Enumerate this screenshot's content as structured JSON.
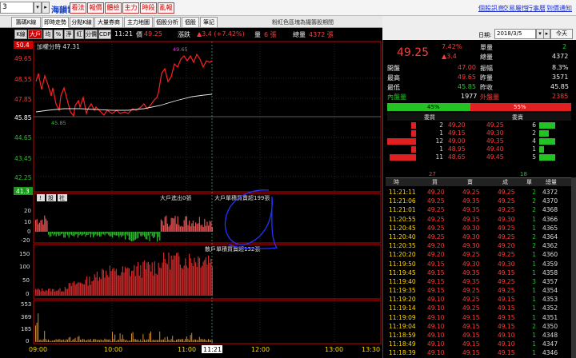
{
  "toolbar": {
    "stock_code": "3",
    "stock_name": "海韻電",
    "buttons": [
      "看法",
      "報價",
      "體檢",
      "主力",
      "時段",
      "亂報"
    ],
    "links": [
      "個股訊息",
      "交易屬性",
      "行事曆",
      "到價通知"
    ]
  },
  "tabs": [
    "籌碼K線",
    "即時走勢",
    "分點K線",
    "大量券商",
    "主力地圖",
    "個股分析",
    "個股",
    "筆記"
  ],
  "active_tab": "即時走勢",
  "chart_title": "粉紅色區塊為撮籌股期間",
  "chart_tools": [
    "K線",
    "大戶",
    "均",
    "%",
    "淨",
    "紅",
    "分價",
    "CDP"
  ],
  "time_display": "11:21",
  "price_label": "價",
  "price_value": "49.25",
  "change_label": "漲跌",
  "change_value": "▲3.4 (+7.42%)",
  "vol_label": "量",
  "vol_value": "6 張",
  "total_label": "總量",
  "total_value": "4372 張",
  "weighted_label": "加權分時 47.31",
  "price_axis": [
    "50.4",
    "49.65",
    "48.55",
    "47.85",
    "45.85",
    "44.65",
    "43.45",
    "42.25",
    "41.3"
  ],
  "open_label": "49.65",
  "low_label": "45.85",
  "panel2": {
    "header": "大戶進出0張",
    "axis": [
      "20",
      "10",
      "0",
      "-20"
    ],
    "annotation": "大戶單積買賣超199張",
    "buttons": [
      "!",
      "設",
      "社"
    ]
  },
  "panel3": {
    "annotation": "散戶單積買賣超132張",
    "axis": [
      "150",
      "100",
      "50",
      "0"
    ]
  },
  "panel4": {
    "axis": [
      "553",
      "369",
      "185",
      "0"
    ]
  },
  "time_axis": [
    "09:00",
    "10:00",
    "11:00",
    "11:21",
    "12:00",
    "13:00",
    "13:30"
  ],
  "date": {
    "label": "日期:",
    "value": "2018/3/5",
    "today": "今天"
  },
  "quote": {
    "price": "49.25",
    "pct": "7.42%",
    "change": "▲3.4",
    "labels": [
      "單量",
      "總量"
    ],
    "values": [
      "2",
      "4372"
    ],
    "rows": [
      {
        "l1": "開盤",
        "v1": "47.00",
        "l2": "振幅",
        "v2": "8.3%"
      },
      {
        "l1": "最高",
        "v1": "49.65",
        "l2": "昨量",
        "v2": "3571"
      },
      {
        "l1": "最低",
        "v1": "45.85",
        "l2": "昨收",
        "v2": "45.85"
      }
    ],
    "inner_label": "內盤量",
    "inner_value": "1977",
    "outer_label": "外盤量",
    "outer_value": "2385",
    "bar_left": "45%",
    "bar_right": "55%",
    "bar_left_frac": 0.45
  },
  "book": {
    "buy_header": "委買",
    "sell_header": "委賣",
    "rows": [
      {
        "bq": "2",
        "bp": "49.20",
        "sp": "49.25",
        "sq": "6"
      },
      {
        "bq": "1",
        "bp": "49.15",
        "sp": "49.30",
        "sq": "2"
      },
      {
        "bq": "12",
        "bp": "49.00",
        "sp": "49.35",
        "sq": "4"
      },
      {
        "bq": "1",
        "bp": "48.95",
        "sp": "49.40",
        "sq": "1"
      },
      {
        "bq": "11",
        "bp": "48.65",
        "sp": "49.45",
        "sq": "5"
      }
    ],
    "buy_total": "27",
    "sell_total": "18"
  },
  "ticks": {
    "headers": [
      "時",
      "買",
      "賣",
      "成",
      "單",
      "總量"
    ],
    "rows": [
      [
        "11:21:11",
        "49.20",
        "49.25",
        "49.25",
        "2",
        "4372"
      ],
      [
        "11:21:06",
        "49.25",
        "49.35",
        "49.25",
        "2",
        "4370"
      ],
      [
        "11:21:01",
        "49.25",
        "49.35",
        "49.25",
        "2",
        "4368"
      ],
      [
        "11:20:55",
        "49.25",
        "49.35",
        "49.30",
        "1",
        "4366"
      ],
      [
        "11:20:45",
        "49.25",
        "49.30",
        "49.25",
        "1",
        "4365"
      ],
      [
        "11:20:40",
        "49.25",
        "49.30",
        "49.25",
        "2",
        "4364"
      ],
      [
        "11:20:35",
        "49.20",
        "49.30",
        "49.20",
        "2",
        "4362"
      ],
      [
        "11:20:20",
        "49.20",
        "49.25",
        "49.25",
        "1",
        "4360"
      ],
      [
        "11:19:50",
        "49.15",
        "49.30",
        "49.30",
        "1",
        "4359"
      ],
      [
        "11:19:45",
        "49.15",
        "49.35",
        "49.15",
        "1",
        "4358"
      ],
      [
        "11:19:40",
        "49.15",
        "49.35",
        "49.25",
        "3",
        "4357"
      ],
      [
        "11:19:35",
        "49.15",
        "49.25",
        "49.25",
        "1",
        "4354"
      ],
      [
        "11:19:20",
        "49.10",
        "49.25",
        "49.15",
        "1",
        "4353"
      ],
      [
        "11:19:14",
        "49.10",
        "49.25",
        "49.15",
        "1",
        "4352"
      ],
      [
        "11:19:09",
        "49.10",
        "49.15",
        "49.15",
        "1",
        "4351"
      ],
      [
        "11:19:04",
        "49.10",
        "49.15",
        "49.15",
        "2",
        "4350"
      ],
      [
        "11:18:59",
        "49.10",
        "49.15",
        "49.10",
        "1",
        "4348"
      ],
      [
        "11:18:49",
        "49.10",
        "49.15",
        "49.10",
        "1",
        "4347"
      ],
      [
        "11:18:39",
        "49.10",
        "49.15",
        "49.15",
        "1",
        "4346"
      ]
    ]
  }
}
